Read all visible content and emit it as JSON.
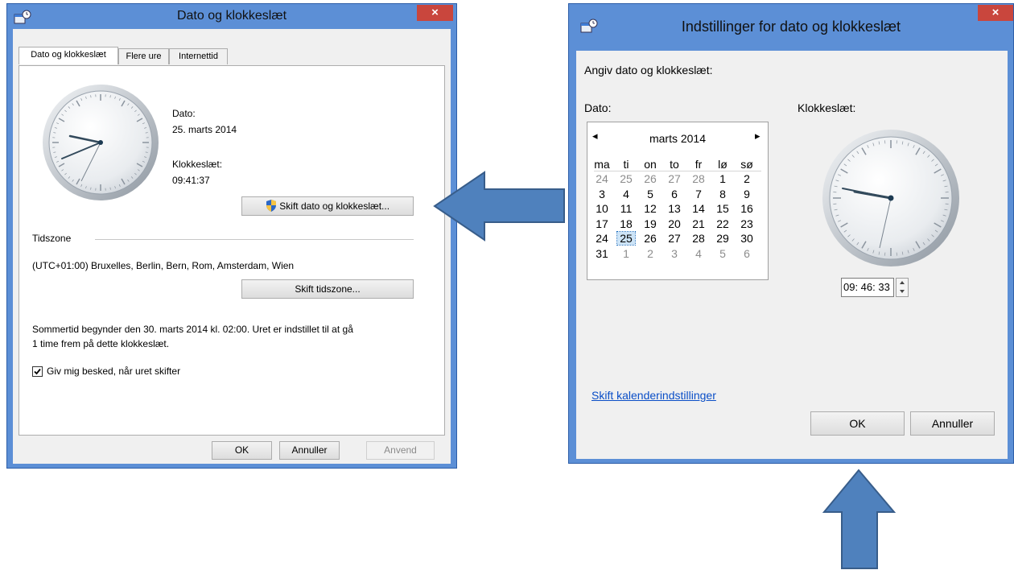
{
  "left_dialog": {
    "title": "Dato og klokkeslæt",
    "close_glyph": "×",
    "tabs": [
      {
        "label": "Dato og klokkeslæt",
        "active": true
      },
      {
        "label": "Flere ure",
        "active": false
      },
      {
        "label": "Internettid",
        "active": false
      }
    ],
    "date_label": "Dato:",
    "date_value": "25. marts 2014",
    "time_label": "Klokkeslæt:",
    "time_value": "09:41:37",
    "change_datetime_button": "Skift dato og klokkeslæt...",
    "timezone_header": "Tidszone",
    "timezone_value": "(UTC+01:00) Bruxelles, Berlin, Bern, Rom, Amsterdam, Wien",
    "change_timezone_button": "Skift tidszone...",
    "dst_line1": "Sommertid begynder den 30. marts 2014 kl. 02:00. Uret er indstillet til at gå",
    "dst_line2": "1 time frem på dette klokkeslæt.",
    "notify_checkbox_label": "Giv mig besked, når uret skifter",
    "notify_checked": true,
    "ok_button": "OK",
    "cancel_button": "Annuller",
    "apply_button": "Anvend"
  },
  "right_dialog": {
    "title": "Indstillinger for dato og klokkeslæt",
    "close_glyph": "×",
    "heading": "Angiv dato og klokkeslæt:",
    "date_label": "Dato:",
    "time_label": "Klokkeslæt:",
    "calendar": {
      "month_label": "marts 2014",
      "prev_glyph": "◂",
      "next_glyph": "▸",
      "weekdays": [
        "ma",
        "ti",
        "on",
        "to",
        "fr",
        "lø",
        "sø"
      ],
      "weeks": [
        [
          "24",
          "25",
          "26",
          "27",
          "28",
          "1",
          "2"
        ],
        [
          "3",
          "4",
          "5",
          "6",
          "7",
          "8",
          "9"
        ],
        [
          "10",
          "11",
          "12",
          "13",
          "14",
          "15",
          "16"
        ],
        [
          "17",
          "18",
          "19",
          "20",
          "21",
          "22",
          "23"
        ],
        [
          "24",
          "25",
          "26",
          "27",
          "28",
          "29",
          "30"
        ],
        [
          "31",
          "1",
          "2",
          "3",
          "4",
          "5",
          "6"
        ]
      ],
      "selected": "25"
    },
    "time_input_value": "09: 46: 33",
    "calendar_settings_link": "Skift kalenderindstillinger",
    "ok_button": "OK",
    "cancel_button": "Annuller"
  },
  "colors": {
    "title_bar": "#5c8fd6",
    "close_button": "#c9463d",
    "arrow_fill": "#4f81bd",
    "arrow_stroke": "#385d8a",
    "link": "#0a4ec7"
  }
}
